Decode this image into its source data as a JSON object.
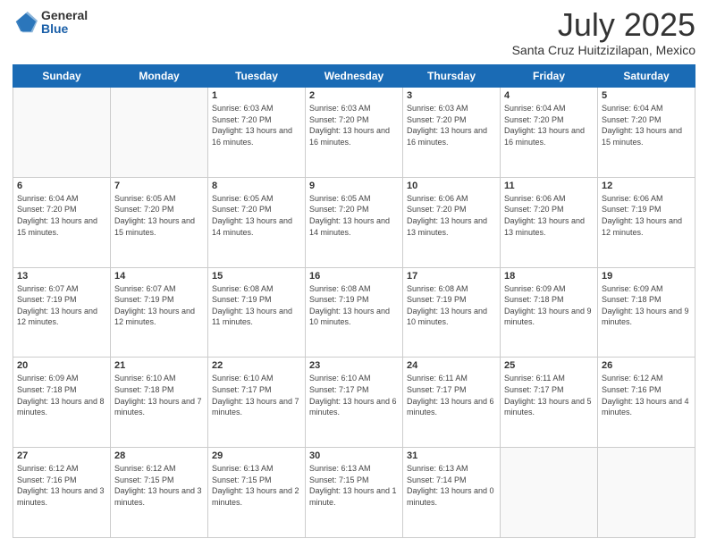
{
  "header": {
    "logo_general": "General",
    "logo_blue": "Blue",
    "month": "July 2025",
    "location": "Santa Cruz Huitzizilapan, Mexico"
  },
  "weekdays": [
    "Sunday",
    "Monday",
    "Tuesday",
    "Wednesday",
    "Thursday",
    "Friday",
    "Saturday"
  ],
  "weeks": [
    [
      {
        "day": "",
        "sunrise": "",
        "sunset": "",
        "daylight": ""
      },
      {
        "day": "",
        "sunrise": "",
        "sunset": "",
        "daylight": ""
      },
      {
        "day": "1",
        "sunrise": "Sunrise: 6:03 AM",
        "sunset": "Sunset: 7:20 PM",
        "daylight": "Daylight: 13 hours and 16 minutes."
      },
      {
        "day": "2",
        "sunrise": "Sunrise: 6:03 AM",
        "sunset": "Sunset: 7:20 PM",
        "daylight": "Daylight: 13 hours and 16 minutes."
      },
      {
        "day": "3",
        "sunrise": "Sunrise: 6:03 AM",
        "sunset": "Sunset: 7:20 PM",
        "daylight": "Daylight: 13 hours and 16 minutes."
      },
      {
        "day": "4",
        "sunrise": "Sunrise: 6:04 AM",
        "sunset": "Sunset: 7:20 PM",
        "daylight": "Daylight: 13 hours and 16 minutes."
      },
      {
        "day": "5",
        "sunrise": "Sunrise: 6:04 AM",
        "sunset": "Sunset: 7:20 PM",
        "daylight": "Daylight: 13 hours and 15 minutes."
      }
    ],
    [
      {
        "day": "6",
        "sunrise": "Sunrise: 6:04 AM",
        "sunset": "Sunset: 7:20 PM",
        "daylight": "Daylight: 13 hours and 15 minutes."
      },
      {
        "day": "7",
        "sunrise": "Sunrise: 6:05 AM",
        "sunset": "Sunset: 7:20 PM",
        "daylight": "Daylight: 13 hours and 15 minutes."
      },
      {
        "day": "8",
        "sunrise": "Sunrise: 6:05 AM",
        "sunset": "Sunset: 7:20 PM",
        "daylight": "Daylight: 13 hours and 14 minutes."
      },
      {
        "day": "9",
        "sunrise": "Sunrise: 6:05 AM",
        "sunset": "Sunset: 7:20 PM",
        "daylight": "Daylight: 13 hours and 14 minutes."
      },
      {
        "day": "10",
        "sunrise": "Sunrise: 6:06 AM",
        "sunset": "Sunset: 7:20 PM",
        "daylight": "Daylight: 13 hours and 13 minutes."
      },
      {
        "day": "11",
        "sunrise": "Sunrise: 6:06 AM",
        "sunset": "Sunset: 7:20 PM",
        "daylight": "Daylight: 13 hours and 13 minutes."
      },
      {
        "day": "12",
        "sunrise": "Sunrise: 6:06 AM",
        "sunset": "Sunset: 7:19 PM",
        "daylight": "Daylight: 13 hours and 12 minutes."
      }
    ],
    [
      {
        "day": "13",
        "sunrise": "Sunrise: 6:07 AM",
        "sunset": "Sunset: 7:19 PM",
        "daylight": "Daylight: 13 hours and 12 minutes."
      },
      {
        "day": "14",
        "sunrise": "Sunrise: 6:07 AM",
        "sunset": "Sunset: 7:19 PM",
        "daylight": "Daylight: 13 hours and 12 minutes."
      },
      {
        "day": "15",
        "sunrise": "Sunrise: 6:08 AM",
        "sunset": "Sunset: 7:19 PM",
        "daylight": "Daylight: 13 hours and 11 minutes."
      },
      {
        "day": "16",
        "sunrise": "Sunrise: 6:08 AM",
        "sunset": "Sunset: 7:19 PM",
        "daylight": "Daylight: 13 hours and 10 minutes."
      },
      {
        "day": "17",
        "sunrise": "Sunrise: 6:08 AM",
        "sunset": "Sunset: 7:19 PM",
        "daylight": "Daylight: 13 hours and 10 minutes."
      },
      {
        "day": "18",
        "sunrise": "Sunrise: 6:09 AM",
        "sunset": "Sunset: 7:18 PM",
        "daylight": "Daylight: 13 hours and 9 minutes."
      },
      {
        "day": "19",
        "sunrise": "Sunrise: 6:09 AM",
        "sunset": "Sunset: 7:18 PM",
        "daylight": "Daylight: 13 hours and 9 minutes."
      }
    ],
    [
      {
        "day": "20",
        "sunrise": "Sunrise: 6:09 AM",
        "sunset": "Sunset: 7:18 PM",
        "daylight": "Daylight: 13 hours and 8 minutes."
      },
      {
        "day": "21",
        "sunrise": "Sunrise: 6:10 AM",
        "sunset": "Sunset: 7:18 PM",
        "daylight": "Daylight: 13 hours and 7 minutes."
      },
      {
        "day": "22",
        "sunrise": "Sunrise: 6:10 AM",
        "sunset": "Sunset: 7:17 PM",
        "daylight": "Daylight: 13 hours and 7 minutes."
      },
      {
        "day": "23",
        "sunrise": "Sunrise: 6:10 AM",
        "sunset": "Sunset: 7:17 PM",
        "daylight": "Daylight: 13 hours and 6 minutes."
      },
      {
        "day": "24",
        "sunrise": "Sunrise: 6:11 AM",
        "sunset": "Sunset: 7:17 PM",
        "daylight": "Daylight: 13 hours and 6 minutes."
      },
      {
        "day": "25",
        "sunrise": "Sunrise: 6:11 AM",
        "sunset": "Sunset: 7:17 PM",
        "daylight": "Daylight: 13 hours and 5 minutes."
      },
      {
        "day": "26",
        "sunrise": "Sunrise: 6:12 AM",
        "sunset": "Sunset: 7:16 PM",
        "daylight": "Daylight: 13 hours and 4 minutes."
      }
    ],
    [
      {
        "day": "27",
        "sunrise": "Sunrise: 6:12 AM",
        "sunset": "Sunset: 7:16 PM",
        "daylight": "Daylight: 13 hours and 3 minutes."
      },
      {
        "day": "28",
        "sunrise": "Sunrise: 6:12 AM",
        "sunset": "Sunset: 7:15 PM",
        "daylight": "Daylight: 13 hours and 3 minutes."
      },
      {
        "day": "29",
        "sunrise": "Sunrise: 6:13 AM",
        "sunset": "Sunset: 7:15 PM",
        "daylight": "Daylight: 13 hours and 2 minutes."
      },
      {
        "day": "30",
        "sunrise": "Sunrise: 6:13 AM",
        "sunset": "Sunset: 7:15 PM",
        "daylight": "Daylight: 13 hours and 1 minute."
      },
      {
        "day": "31",
        "sunrise": "Sunrise: 6:13 AM",
        "sunset": "Sunset: 7:14 PM",
        "daylight": "Daylight: 13 hours and 0 minutes."
      },
      {
        "day": "",
        "sunrise": "",
        "sunset": "",
        "daylight": ""
      },
      {
        "day": "",
        "sunrise": "",
        "sunset": "",
        "daylight": ""
      }
    ]
  ]
}
